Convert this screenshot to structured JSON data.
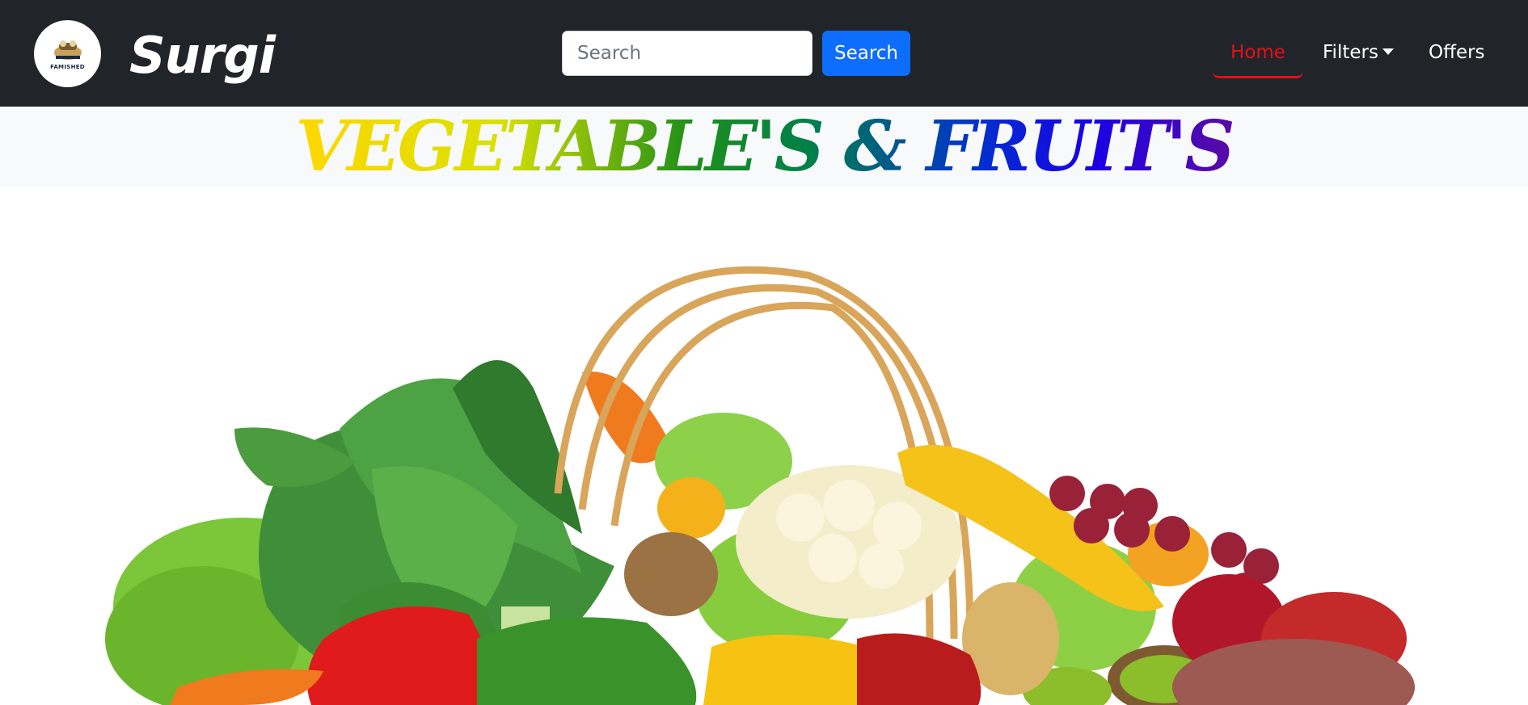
{
  "header": {
    "logo_text": "FAMISHED",
    "brand": "Surgi",
    "search": {
      "placeholder": "Search",
      "value": "",
      "button_label": "Search"
    },
    "nav": [
      {
        "label": "Home",
        "active": true
      },
      {
        "label": "Filters",
        "has_dropdown": true
      },
      {
        "label": "Offers"
      }
    ],
    "colors": {
      "background": "#212529",
      "active": "#e0111b",
      "button": "#0d6efd"
    }
  },
  "banner": {
    "title": "VEGETABLE'S & FRUIT'S"
  },
  "hero": {
    "image": "vegetables-and-fruits-basket"
  }
}
